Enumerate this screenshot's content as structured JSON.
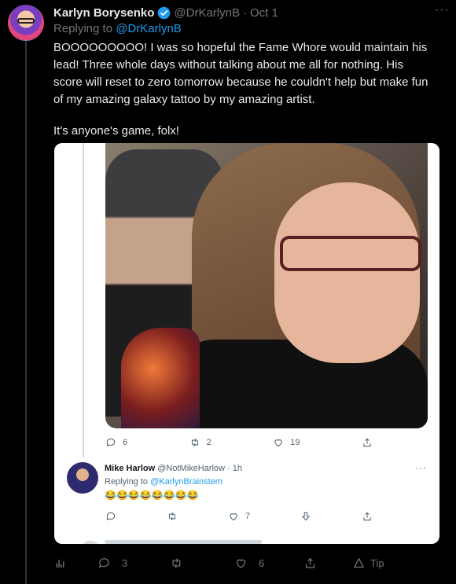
{
  "tweet": {
    "author_name": "Karlyn Borysenko",
    "author_handle": "@DrKarlynB",
    "separator": "·",
    "date": "Oct 1",
    "replying_prefix": "Replying to",
    "replying_to": "@DrKarlynB",
    "text_p1": "BOOOOOOOOO! I was so hopeful the Fame Whore would maintain his lead! Three whole days without talking about me all for nothing. His score will reset to zero tomorrow because he couldn't help but make fun of my amazing galaxy tattoo by my amazing artist.",
    "text_p2": "It's anyone's game, folx!"
  },
  "quoted_tweet": {
    "reply_count": "6",
    "retweet_count": "2",
    "like_count": "19"
  },
  "quoted_reply": {
    "author_name": "Mike Harlow",
    "author_handle": "@NotMikeHarlow",
    "time": "1h",
    "replying_prefix": "Replying to",
    "replying_to": "@KarlynBrainstem",
    "emojis": "😂😂😂😂😂😂😂😂",
    "like_count": "7"
  },
  "actions": {
    "reply_count": "3",
    "like_count": "6",
    "tip_label": "Tip"
  },
  "colors": {
    "accent": "#1d9bf0",
    "background": "#000000",
    "muted": "#71767b"
  },
  "icons": [
    "verified-icon",
    "more-icon",
    "reply-icon",
    "retweet-icon",
    "like-icon",
    "share-icon",
    "analytics-icon",
    "tip-icon"
  ]
}
